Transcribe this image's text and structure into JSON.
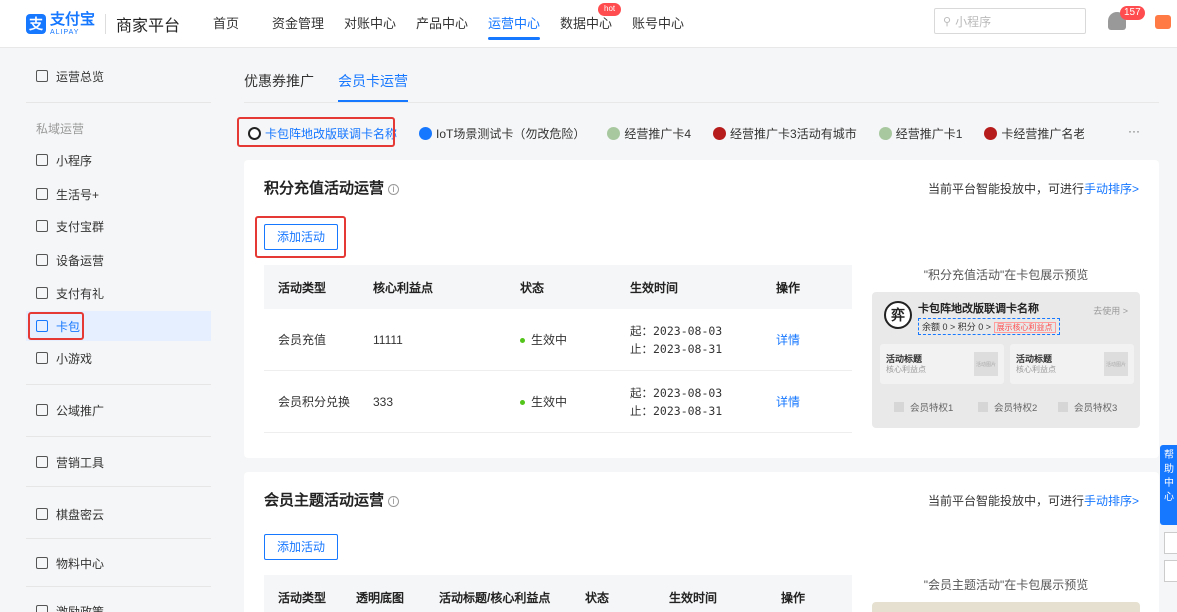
{
  "header": {
    "logo_cn": "支付宝",
    "logo_en": "ALIPAY",
    "logo_mark": "支",
    "platform": "商家平台",
    "nav": [
      {
        "label": "首页",
        "active": false
      },
      {
        "label": "资金管理",
        "active": false
      },
      {
        "label": "对账中心",
        "active": false
      },
      {
        "label": "产品中心",
        "active": false
      },
      {
        "label": "运营中心",
        "active": true
      },
      {
        "label": "数据中心",
        "active": false,
        "badge": "hot"
      },
      {
        "label": "账号中心",
        "active": false
      }
    ],
    "search_placeholder": "小程序",
    "notification_count": "157"
  },
  "sidebar": {
    "overview": "运营总览",
    "group_private": "私域运营",
    "items": [
      "小程序",
      "生活号+",
      "支付宝群",
      "设备运营",
      "支付有礼",
      "卡包",
      "小游戏"
    ],
    "active_item": "卡包",
    "public": "公域推广",
    "marketing": "营销工具",
    "chess": "棋盘密云",
    "materials": "物料中心",
    "incentive": "激励政策"
  },
  "main": {
    "tabs": [
      {
        "label": "优惠券推广",
        "active": false
      },
      {
        "label": "会员卡运营",
        "active": true
      }
    ],
    "cards": [
      {
        "label": "卡包阵地改版联调卡名称",
        "active": true,
        "color": "#222222"
      },
      {
        "label": "IoT场景测试卡（勿改危险）",
        "active": false,
        "color": "#1677ff"
      },
      {
        "label": "经营推广卡4",
        "active": false,
        "color": "#a8c8a0"
      },
      {
        "label": "经营推广卡3活动有城市",
        "active": false,
        "color": "#b71c1c"
      },
      {
        "label": "经营推广卡1",
        "active": false,
        "color": "#a8c8a0"
      },
      {
        "label": "卡经营推广名老客无",
        "active": false,
        "color": "#b71c1c"
      }
    ],
    "more": "···",
    "points_panel": {
      "title": "积分充值活动运营",
      "right_text": "当前平台智能投放中，可进行",
      "right_link": "手动排序>",
      "add_button": "添加活动",
      "columns": [
        "活动类型",
        "核心利益点",
        "状态",
        "生效时间",
        "操作"
      ],
      "rows": [
        {
          "type": "会员充值",
          "benefit": "11111",
          "status": "生效中",
          "start": "起：2023-08-03",
          "end": "止：2023-08-31",
          "action": "详情"
        },
        {
          "type": "会员积分兑换",
          "benefit": "333",
          "status": "生效中",
          "start": "起：2023-08-03",
          "end": "止：2023-08-31",
          "action": "详情"
        }
      ],
      "preview_title": "\"积分充值活动\"在卡包展示预览",
      "preview": {
        "logo": "弈",
        "card_name": "卡包阵地改版联调卡名称",
        "use_link": "去使用 >",
        "balance": "余额 0 >",
        "points": "积分 0 >",
        "tag": "展示核心利益点",
        "box1_title": "活动标题",
        "box1_sub": "核心利益点",
        "box2_title": "活动标题",
        "box2_sub": "核心利益点",
        "box_img": "活动图片",
        "privileges": [
          "会员特权1",
          "会员特权2",
          "会员特权3"
        ]
      }
    },
    "theme_panel": {
      "title": "会员主题活动运营",
      "right_text": "当前平台智能投放中，可进行",
      "right_link": "手动排序>",
      "add_button": "添加活动",
      "columns": [
        "活动类型",
        "透明底图",
        "活动标题/核心利益点",
        "状态",
        "生效时间",
        "操作"
      ],
      "preview_title": "\"会员主题活动\"在卡包展示预览"
    }
  },
  "float_tab": "帮助中心"
}
